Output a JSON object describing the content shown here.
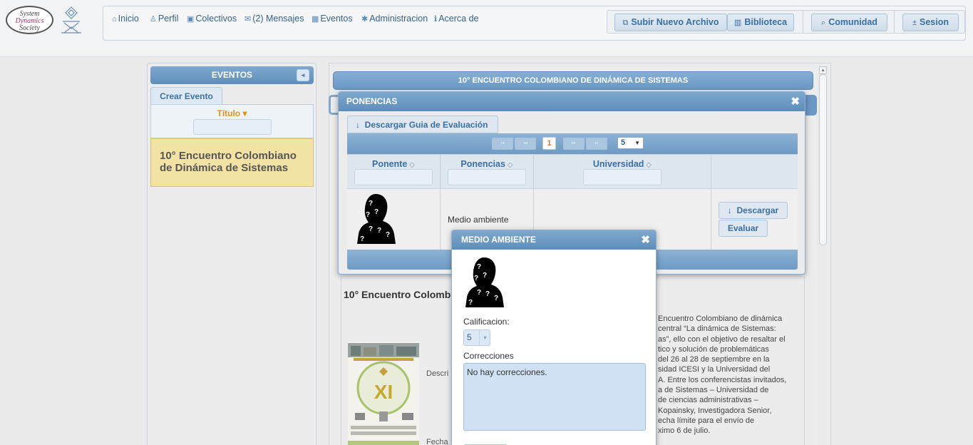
{
  "logo": {
    "line1": "System",
    "line2": "Dynamics",
    "line3": "Society"
  },
  "nav": {
    "items": [
      {
        "icon": "home-icon",
        "glyph": "⌂",
        "label": "Inicio"
      },
      {
        "icon": "user-icon",
        "glyph": "♙",
        "label": "Perfil"
      },
      {
        "icon": "groups-icon",
        "glyph": "▣",
        "label": "Colectivos"
      },
      {
        "icon": "mail-icon",
        "glyph": "✉",
        "label": "(2) Mensajes"
      },
      {
        "icon": "calendar-icon",
        "glyph": "▦",
        "label": "Eventos"
      },
      {
        "icon": "gear-icon",
        "glyph": "✱",
        "label": "Administracion"
      },
      {
        "icon": "info-icon",
        "glyph": "ℹ",
        "label": "Acerca de"
      }
    ]
  },
  "toolbar": {
    "upload": {
      "icon": "upload-icon",
      "glyph": "⧉",
      "label": "Subir Nuevo Archivo"
    },
    "library": {
      "icon": "library-icon",
      "glyph": "▥",
      "label": "Biblioteca"
    },
    "community": {
      "icon": "search-icon",
      "glyph": "⌕",
      "label": "Comunidad"
    },
    "session": {
      "icon": "session-icon",
      "glyph": "±",
      "label": "Sesion"
    }
  },
  "sidebar": {
    "header": "EVENTOS",
    "collapse_glyph": "◂",
    "create_tab": "Crear Evento",
    "filter_label": "Título",
    "filter_arrow": "▾",
    "events": [
      "10° Encuentro Colombiano de Dinámica de Sistemas"
    ]
  },
  "main": {
    "event_title": "10° ENCUENTRO COLOMBIANO DE DINÁMICA DE SISTEMAS",
    "content_heading": "10° Encuentro Colomb",
    "description_label": "Descri",
    "date_label": "Fecha",
    "description_lines": [
      "Encuentro Colombiano de dinámica",
      "central “La dinámica de Sistemas:",
      "as”, ello con el objetivo de resaltar el",
      "tico y solución de problemáticas",
      "del 26 al 28 de septiembre en la",
      "sidad ICESI y la Universidad del",
      "A. Entre los conferencistas invitados,",
      "a de Sistemas – Universidad de",
      "de ciencias administrativas –",
      "Kopainsky, Investigadora Senior,",
      "echa límite para el envío de",
      "ximo 6 de julio."
    ]
  },
  "ponencias": {
    "title": "PONENCIAS",
    "close_glyph": "✖",
    "guide_button": {
      "glyph": "↓",
      "label": "Descargar Guia de Evaluación"
    },
    "pager": {
      "first": "|◂",
      "prev": "◂◂",
      "current_page": "1",
      "next": "▸▸",
      "last": "▸|",
      "page_size": "5",
      "size_arrow": "▼"
    },
    "columns": [
      "Ponente",
      "Ponencias",
      "Universidad"
    ],
    "sort_glyph": "◇",
    "rows": [
      {
        "ponencia": "Medio ambiente",
        "universidad": ""
      }
    ],
    "download_button": {
      "glyph": "↓",
      "label": "Descargar"
    },
    "evaluate_button": "Evaluar"
  },
  "medio_dialog": {
    "title": "MEDIO AMBIENTE",
    "close_glyph": "✖",
    "rating_label": "Calificacion:",
    "rating_value": "5",
    "rating_arrow": "▾",
    "corrections_label": "Correcciones",
    "corrections_value": "No hay correcciones."
  },
  "scrollbar": {
    "up_glyph": "▴"
  }
}
